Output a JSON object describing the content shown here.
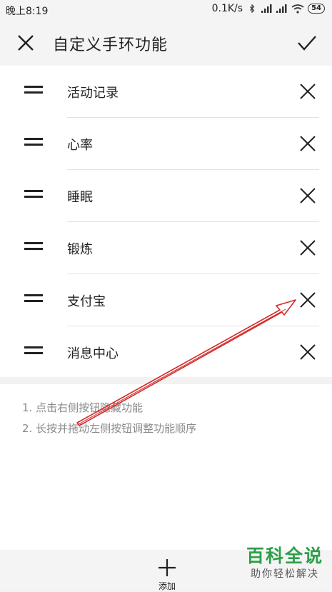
{
  "status_bar": {
    "time": "晚上8:19",
    "network_speed": "0.1K/s",
    "battery": "54"
  },
  "header": {
    "title": "自定义手环功能",
    "close_icon": "close-icon",
    "confirm_icon": "check-icon"
  },
  "functions": [
    {
      "label": "活动记录"
    },
    {
      "label": "心率"
    },
    {
      "label": "睡眠"
    },
    {
      "label": "锻炼"
    },
    {
      "label": "支付宝"
    },
    {
      "label": "消息中心"
    }
  ],
  "tips": [
    "1. 点击右侧按钮隐藏功能",
    "2. 长按并拖动左侧按钮调整功能顺序"
  ],
  "bottom": {
    "add_label": "添加",
    "add_icon": "plus-icon"
  },
  "watermark": {
    "title": "百科全说",
    "subtitle": "助你轻松解决"
  },
  "colors": {
    "annotation": "#d42a2a",
    "watermark": "#2e9e48"
  }
}
